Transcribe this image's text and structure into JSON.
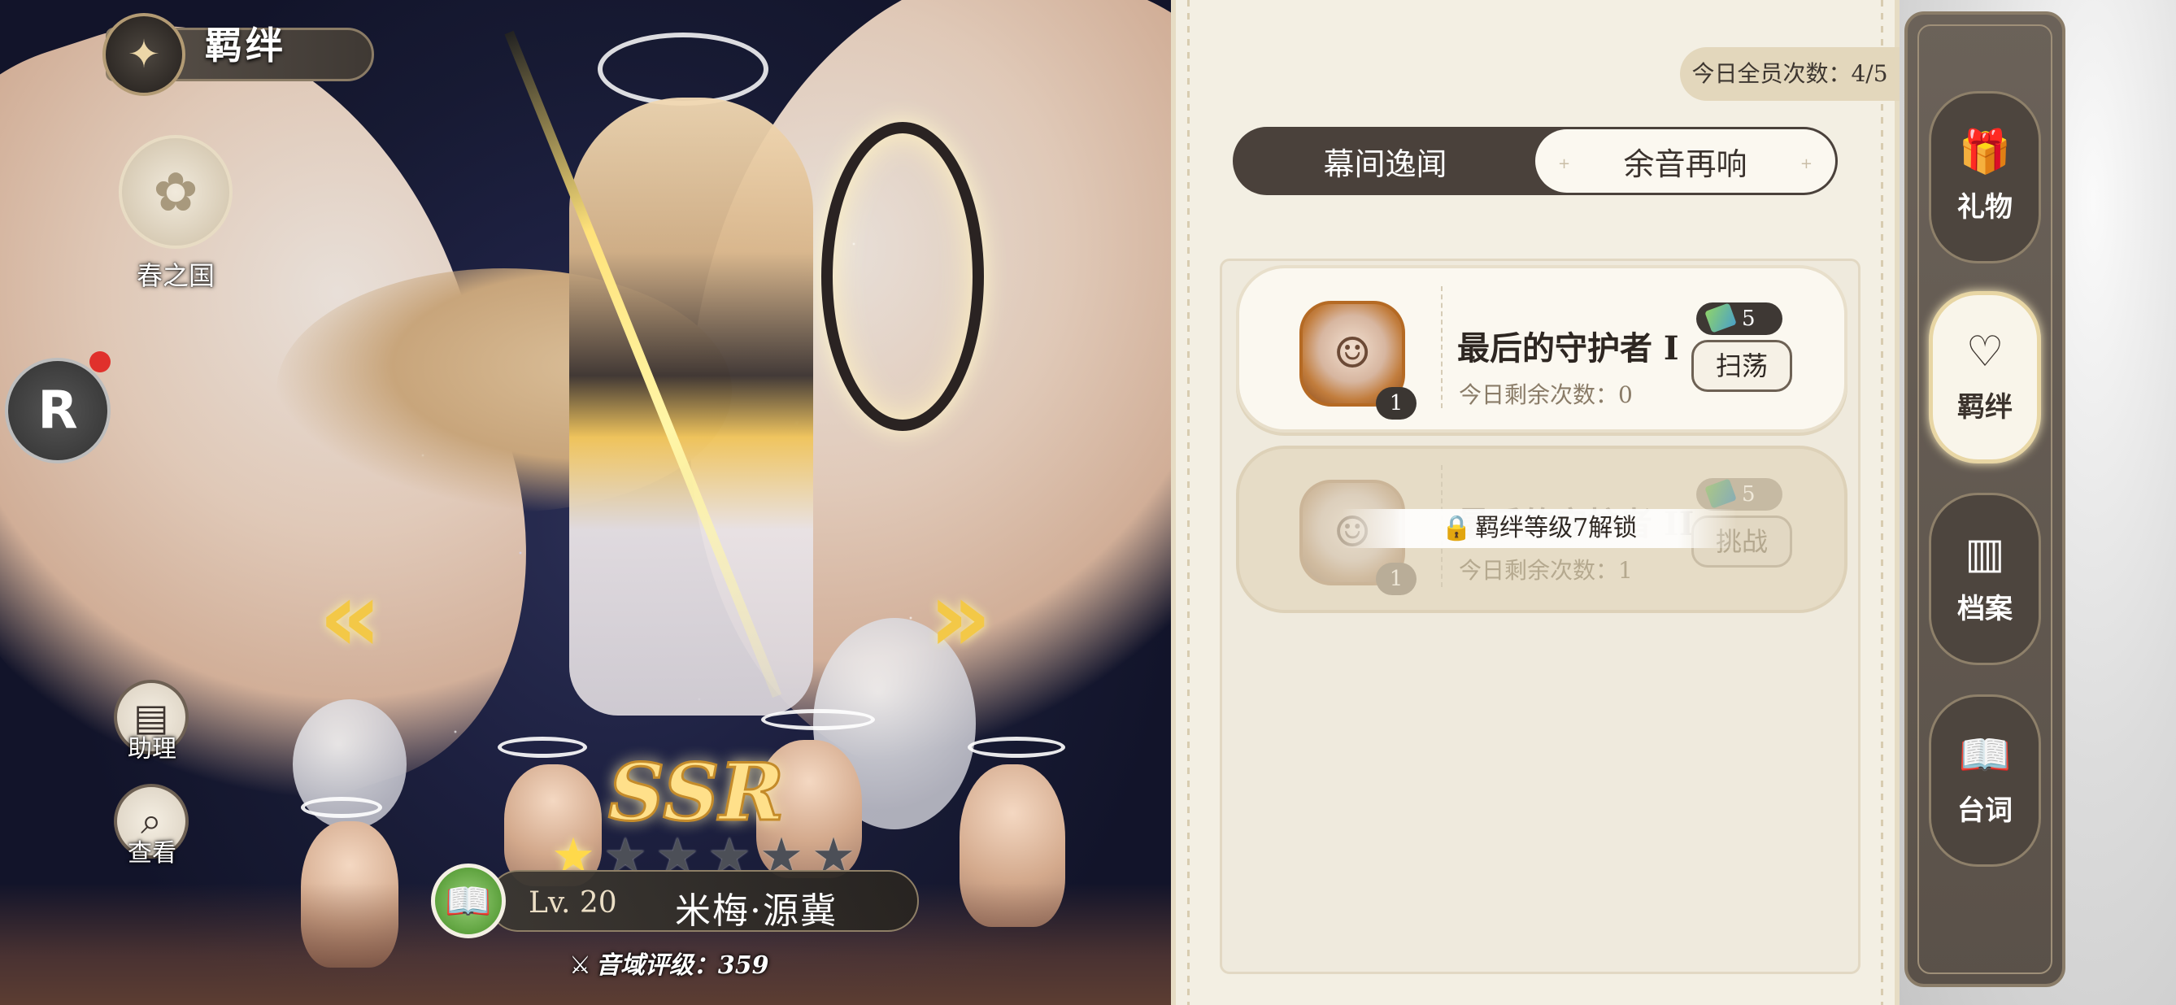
{
  "header": {
    "title": "羁绊",
    "emblem_icon": "compass-emblem-icon"
  },
  "left": {
    "nation": {
      "label": "春之国",
      "icon": "sakura-crest-icon"
    },
    "r_button": {
      "label": "R",
      "has_notification": true
    },
    "assist": {
      "label": "助理",
      "icon": "assistant-card-icon"
    },
    "view": {
      "label": "查看",
      "icon": "magnifier-icon"
    },
    "prev_arrow": "«",
    "next_arrow": "»"
  },
  "character": {
    "rarity": "SSR",
    "stars_filled": 1,
    "stars_total": 6,
    "level_text": "Lv. 20",
    "name": "米梅·源冀",
    "rating_label": "音域评级：",
    "rating_value": "359",
    "book_icon": "story-book-icon"
  },
  "panel": {
    "daily_count": "今日全员次数：4/5",
    "tabs": [
      {
        "label": "幕间逸闻",
        "active": false
      },
      {
        "label": "余音再响",
        "active": true
      }
    ],
    "stages": [
      {
        "title": "最后的守护者 I",
        "remaining": "今日剩余次数：0",
        "level_badge": "1",
        "ticket_cost": "5",
        "action": "扫荡",
        "locked": false
      },
      {
        "title": "最后的守护者 II",
        "remaining": "今日剩余次数：1",
        "level_badge": "1",
        "ticket_cost": "5",
        "action": "挑战",
        "locked": true,
        "lock_text": "羁绊等级7解锁"
      }
    ]
  },
  "sidebar": {
    "items": [
      {
        "label": "礼物",
        "icon": "gift-icon",
        "active": false
      },
      {
        "label": "羁绊",
        "icon": "heart-bond-icon",
        "active": true
      },
      {
        "label": "档案",
        "icon": "archive-icon",
        "active": false
      },
      {
        "label": "台词",
        "icon": "open-book-icon",
        "active": false
      }
    ]
  },
  "colors": {
    "panel_bg": "#f3efe3",
    "tab_dark": "#4a413b",
    "rail": "#5a5149",
    "star_on": "#ffd94a",
    "ssr_gold": "#ffe08a",
    "notification_red": "#e0312c"
  }
}
